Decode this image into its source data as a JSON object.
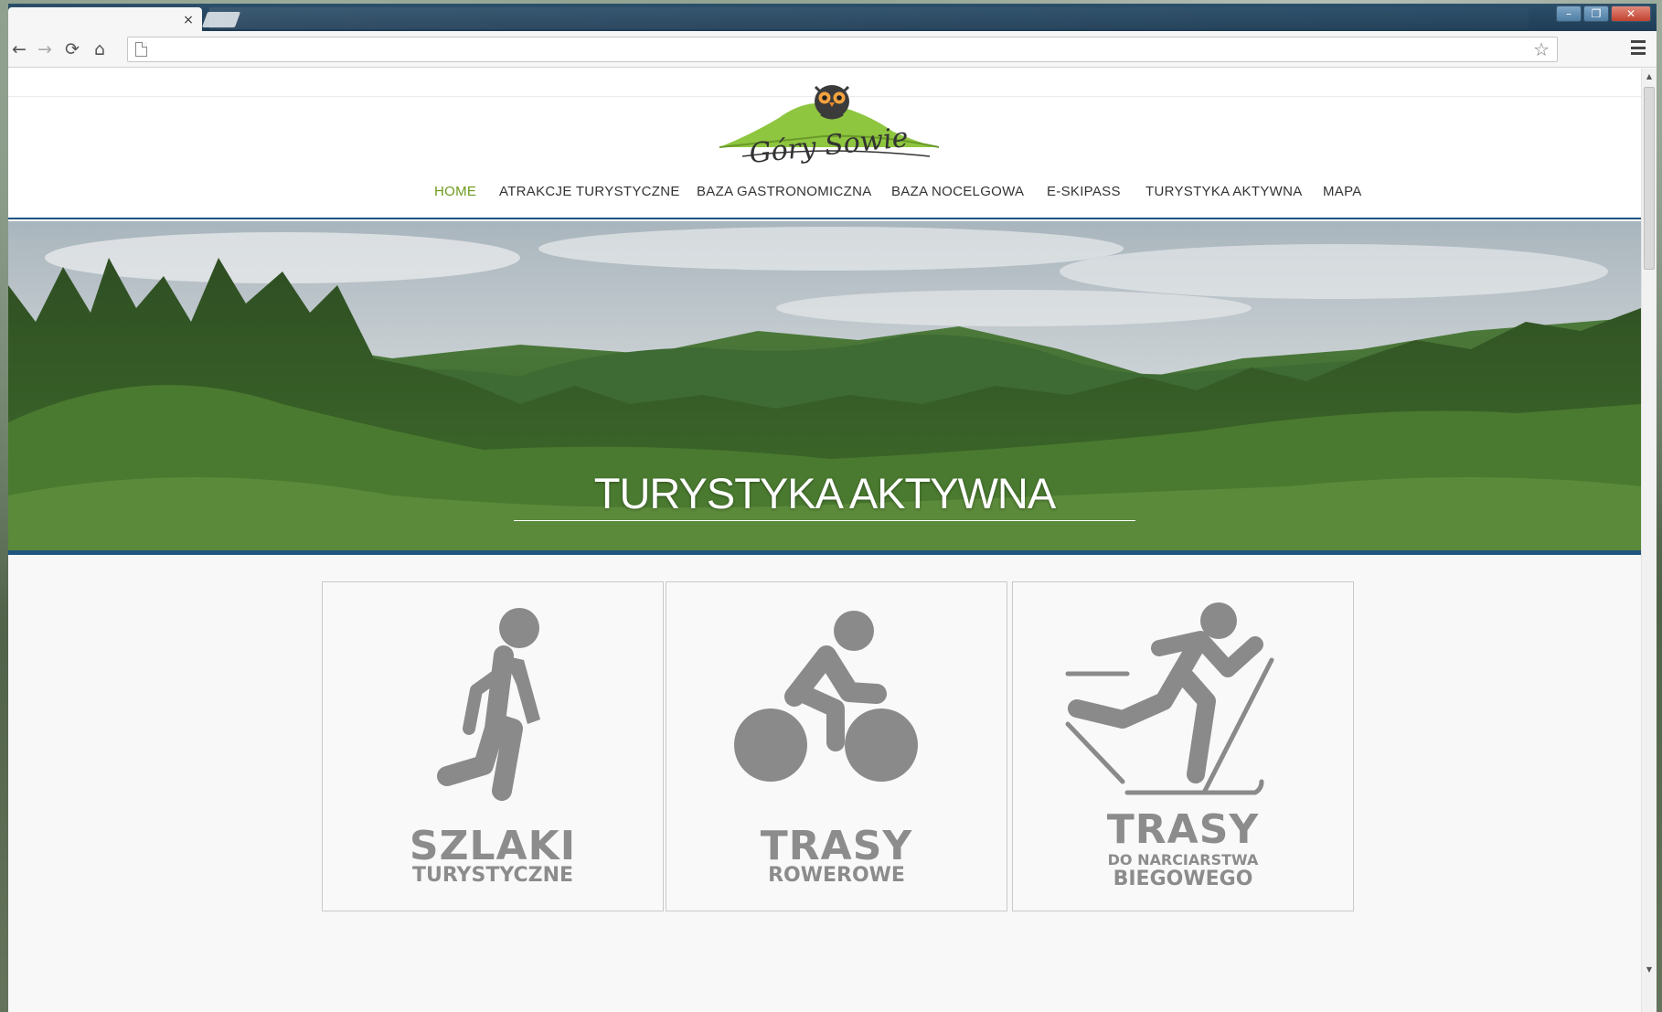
{
  "browser": {
    "tab_close_label": "×",
    "back_icon": "arrow-left-icon",
    "forward_icon": "arrow-right-icon",
    "reload_icon": "reload-icon",
    "home_icon": "home-icon",
    "window_controls": [
      "–",
      "❐",
      "✕"
    ]
  },
  "site": {
    "logo_text": "Góry Sowie",
    "nav": [
      {
        "label": "HOME",
        "active": true
      },
      {
        "label": "ATRAKCJE TURYSTYCZNE",
        "active": false
      },
      {
        "label": "BAZA GASTRONOMICZNA",
        "active": false
      },
      {
        "label": "BAZA NOCELGOWA",
        "active": false
      },
      {
        "label": "E-SKIPASS",
        "active": false
      },
      {
        "label": "TURYSTYKA AKTYWNA",
        "active": false
      },
      {
        "label": "MAPA",
        "active": false
      }
    ],
    "accent_color": "#6e9a1c",
    "brand_blue": "#1f5580"
  },
  "hero": {
    "title": "TURYSTYKA AKTYWNA"
  },
  "cards": [
    {
      "icon": "hiker-icon",
      "title": "SZLAKI",
      "subtitle": "TURYSTYCZNE"
    },
    {
      "icon": "cyclist-icon",
      "title": "TRASY",
      "subtitle": "ROWEROWE"
    },
    {
      "icon": "cross-country-skier-icon",
      "title": "TRASY",
      "subtitle_small": "DO NARCIARSTWA",
      "subtitle": "BIEGOWEGO"
    }
  ]
}
